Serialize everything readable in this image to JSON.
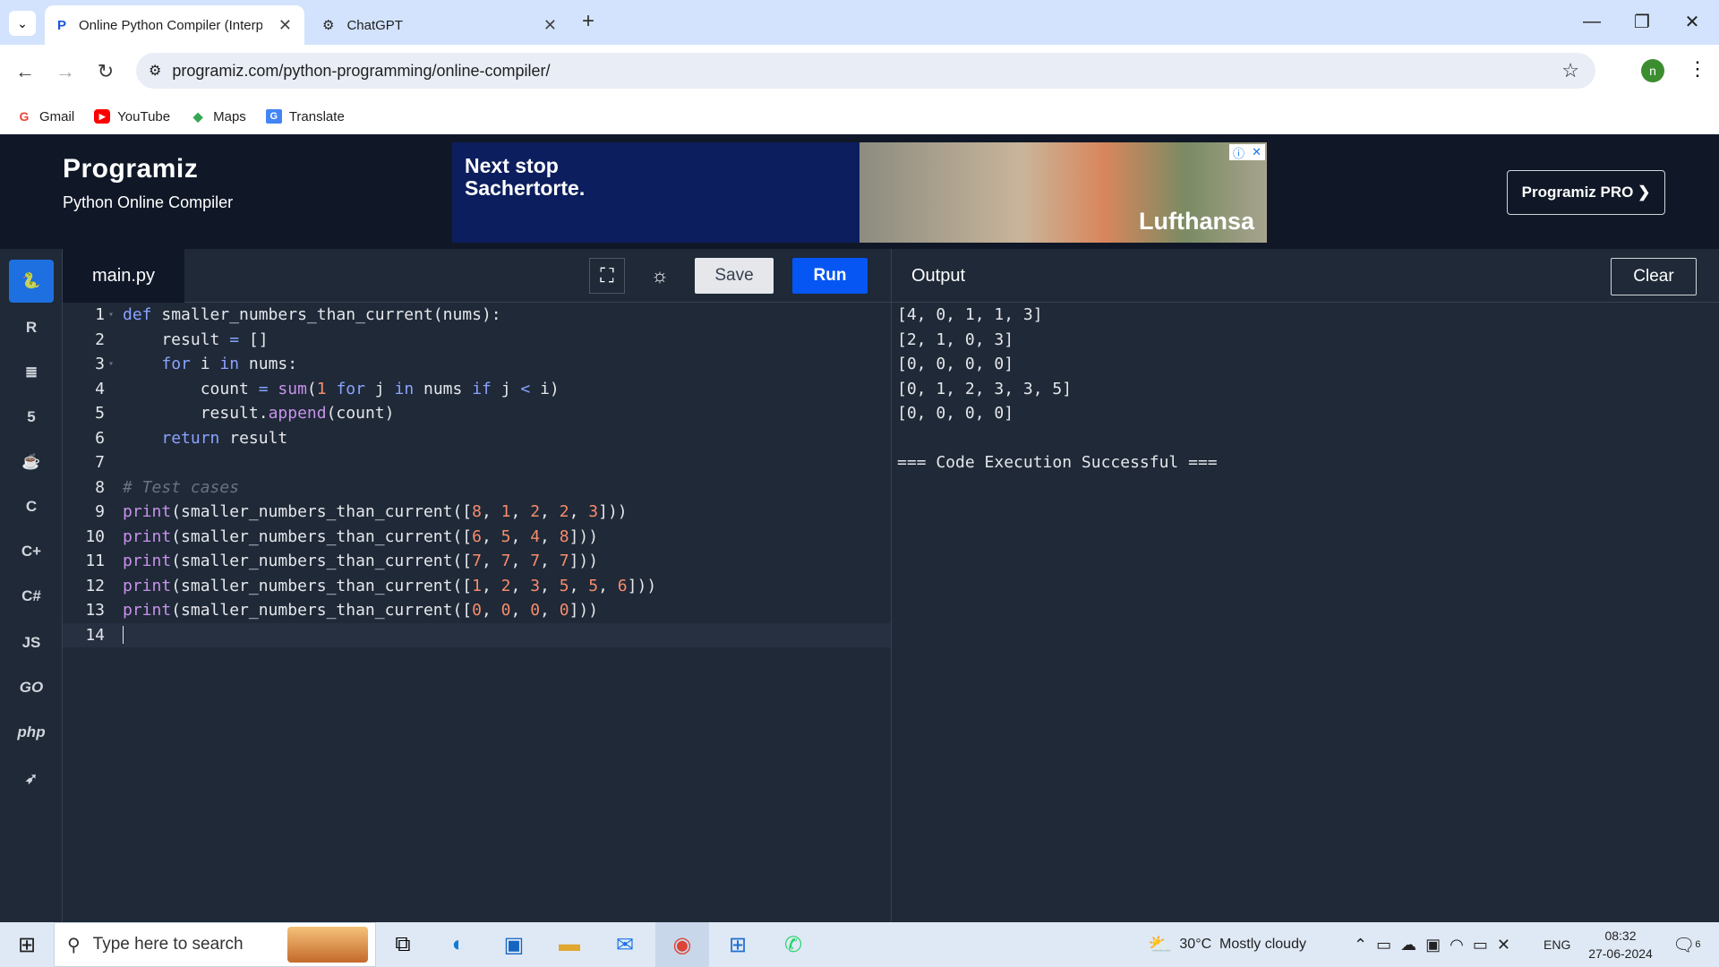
{
  "browser": {
    "tabs": [
      {
        "title": "Online Python Compiler (Interp",
        "active": true
      },
      {
        "title": "ChatGPT",
        "active": false
      }
    ],
    "url": "programiz.com/python-programming/online-compiler/",
    "profile_initial": "n",
    "bookmarks": [
      "Gmail",
      "YouTube",
      "Maps",
      "Translate"
    ]
  },
  "header": {
    "brand": "Programiz",
    "subtitle": "Python Online Compiler",
    "pro_button": "Programiz PRO ❯"
  },
  "ad": {
    "headline_1": "Next stop",
    "headline_2": "Sachertorte.",
    "brand": "Lufthansa"
  },
  "sidebar": {
    "languages": [
      "python-icon",
      "r-icon",
      "sql-icon",
      "html-icon",
      "java-icon",
      "c-icon",
      "cpp-icon",
      "csharp-icon",
      "JS",
      "GO",
      "php",
      "swift-icon"
    ]
  },
  "editor": {
    "filename": "main.py",
    "save_label": "Save",
    "run_label": "Run",
    "line_numbers": [
      "1",
      "2",
      "3",
      "4",
      "5",
      "6",
      "7",
      "8",
      "9",
      "10",
      "11",
      "12",
      "13",
      "14"
    ]
  },
  "output": {
    "label": "Output",
    "clear_label": "Clear",
    "lines": [
      "[4, 0, 1, 1, 3]",
      "[2, 1, 0, 3]",
      "[0, 0, 0, 0]",
      "[0, 1, 2, 3, 3, 5]",
      "[0, 0, 0, 0]",
      "",
      "=== Code Execution Successful ==="
    ]
  },
  "taskbar": {
    "search_placeholder": "Type here to search",
    "weather": "30°C  Mostly cloudy",
    "language": "ENG",
    "time": "08:32",
    "date": "27-06-2024",
    "notifications": "6"
  }
}
